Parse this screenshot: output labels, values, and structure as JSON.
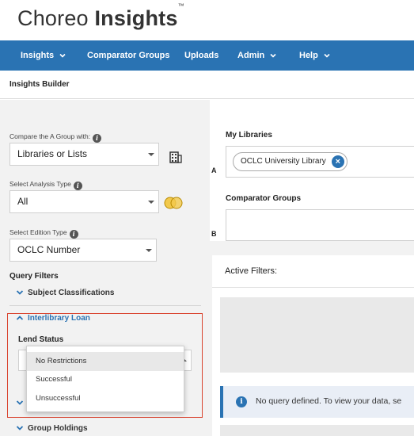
{
  "logo": {
    "prefix": "Choreo ",
    "bold": "Insights",
    "tm": "™"
  },
  "nav": {
    "items": [
      {
        "label": "Insights",
        "dropdown": true
      },
      {
        "label": "Comparator Groups",
        "dropdown": false
      },
      {
        "label": "Uploads",
        "dropdown": false
      },
      {
        "label": "Admin",
        "dropdown": true
      },
      {
        "label": "Help",
        "dropdown": true
      }
    ]
  },
  "page_title": "Insights Builder",
  "left": {
    "compare_label": "Compare the A Group with:",
    "compare_value": "Libraries or Lists",
    "analysis_label": "Select Analysis Type",
    "analysis_value": "All",
    "edition_label": "Select Edition Type",
    "edition_value": "OCLC Number",
    "query_filters_title": "Query Filters",
    "subject_classifications": "Subject Classifications",
    "interlibrary_loan": "Interlibrary Loan",
    "lend_status_label": "Lend Status",
    "group_holdings": "Group Holdings",
    "lend_status_options": [
      "No Restrictions",
      "Successful",
      "Unsuccessful"
    ],
    "lend_status_selected": "No Restrictions"
  },
  "right": {
    "a_label": "A",
    "b_label": "B",
    "my_libraries_label": "My Libraries",
    "library_chip": "OCLC University Library",
    "comparator_groups_label": "Comparator Groups",
    "active_filters_label": "Active Filters:",
    "notice_text": "No query defined. To view your data, se"
  },
  "colors": {
    "brand_blue": "#2a73b3",
    "highlight_red": "#d9442f",
    "venn_yellow": "#f2c94c"
  }
}
